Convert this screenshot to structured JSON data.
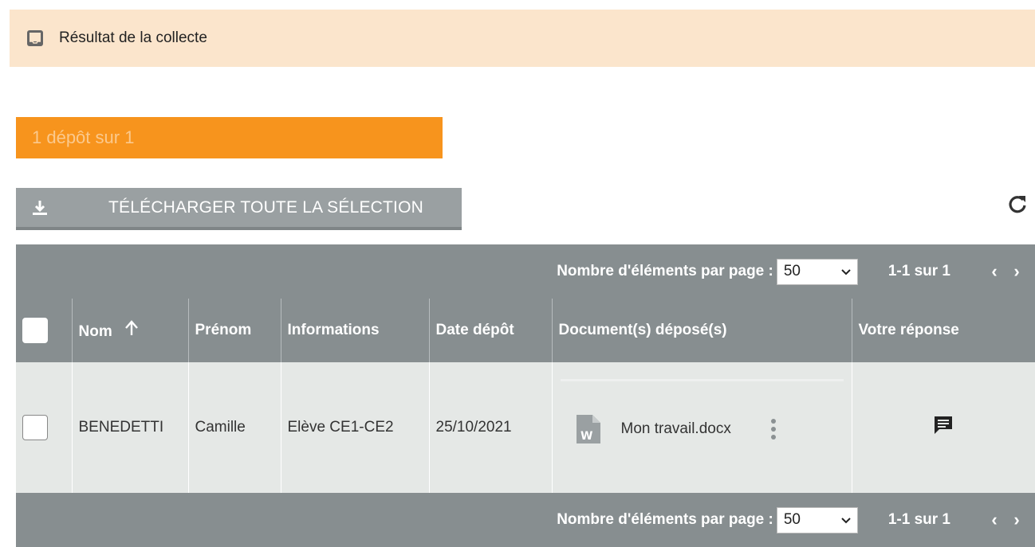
{
  "header": {
    "title": "Résultat de la collecte",
    "icon": "inbox-icon"
  },
  "count_bar": {
    "text": "1 dépôt sur 1",
    "color": "#f7941d"
  },
  "toolbar": {
    "download_all_label": "TÉLÉCHARGER TOUTE LA SÉLECTION",
    "refresh_icon": "refresh-icon"
  },
  "pager": {
    "per_page_label": "Nombre d'éléments par page :",
    "per_page_value": "50",
    "range": "1-1 sur 1",
    "prev": "‹",
    "next": "›"
  },
  "table": {
    "columns": [
      "Nom",
      "Prénom",
      "Informations",
      "Date dépôt",
      "Document(s) déposé(s)",
      "Votre réponse"
    ],
    "rows": [
      {
        "nom": "BENEDETTI",
        "prenom": "Camille",
        "informations": "Elève CE1-CE2",
        "date": "25/10/2021",
        "document": "Mon travail.docx",
        "document_icon": "word-file-icon",
        "reply_icon": "comment-icon"
      }
    ]
  },
  "colors": {
    "header_bg": "#fbe5cc",
    "table_header": "#878e90",
    "row_bg": "#e5e8e6",
    "button": "#9aa0a2"
  }
}
